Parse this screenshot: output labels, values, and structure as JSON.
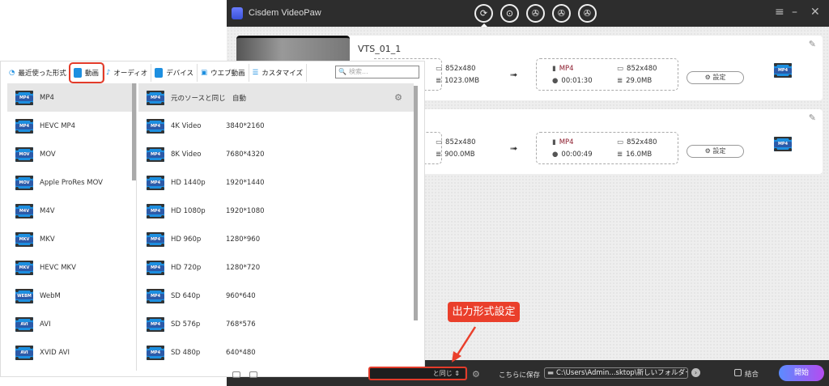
{
  "app": {
    "title": "Cisdem VideoPaw",
    "nav_icons": [
      "convert-icon",
      "dvd-convert-icon",
      "video-download-icon",
      "video-edit-icon",
      "video-compress-icon"
    ]
  },
  "files": [
    {
      "name": "VTS_01_1",
      "src_resolution": "852x480",
      "src_size": "1023.0MB",
      "dst_format": "MP4",
      "dst_resolution": "852x480",
      "dst_duration": "00:01:30",
      "dst_size": "29.0MB",
      "settings_label": "設定",
      "badge": "MP4"
    },
    {
      "name": "",
      "src_resolution": "852x480",
      "src_size": "900.0MB",
      "dst_format": "MP4",
      "dst_resolution": "852x480",
      "dst_duration": "00:00:49",
      "dst_size": "16.0MB",
      "settings_label": "設定",
      "badge": "MP4"
    }
  ],
  "popup": {
    "tabs": [
      "最近使った形式",
      "動画",
      "オーディオ",
      "デバイス",
      "ウエブ動画",
      "カスタマイズ"
    ],
    "selected_tab": "動画",
    "search_placeholder": "検索...",
    "formats": [
      {
        "label": "MP4",
        "badge": "MP4"
      },
      {
        "label": "HEVC MP4",
        "badge": "MP4"
      },
      {
        "label": "MOV",
        "badge": "MOV"
      },
      {
        "label": "Apple ProRes MOV",
        "badge": "MOV"
      },
      {
        "label": "M4V",
        "badge": "M4V"
      },
      {
        "label": "MKV",
        "badge": "MKV"
      },
      {
        "label": "HEVC MKV",
        "badge": "MKV"
      },
      {
        "label": "WebM",
        "badge": "WEBM"
      },
      {
        "label": "AVI",
        "badge": "AVI"
      },
      {
        "label": "XVID AVI",
        "badge": "AVI"
      }
    ],
    "presets": [
      {
        "label": "元のソースと同じ",
        "res": "自動"
      },
      {
        "label": "4K Video",
        "res": "3840*2160"
      },
      {
        "label": "8K Video",
        "res": "7680*4320"
      },
      {
        "label": "HD 1440p",
        "res": "1920*1440"
      },
      {
        "label": "HD 1080p",
        "res": "1920*1080"
      },
      {
        "label": "HD 960p",
        "res": "1280*960"
      },
      {
        "label": "HD 720p",
        "res": "1280*720"
      },
      {
        "label": "SD 640p",
        "res": "960*640"
      },
      {
        "label": "SD 576p",
        "res": "768*576"
      },
      {
        "label": "SD 480p",
        "res": "640*480"
      }
    ]
  },
  "bottom": {
    "format_value": "と同じ",
    "save_label": "こちらに保存",
    "save_path": "C:\\Users\\Admin...sktop\\新しいフォルダー",
    "merge_label": "結合",
    "start_label": "開始"
  },
  "annotation": {
    "callout": "出力形式設定",
    "color": "#ea3f2b"
  }
}
